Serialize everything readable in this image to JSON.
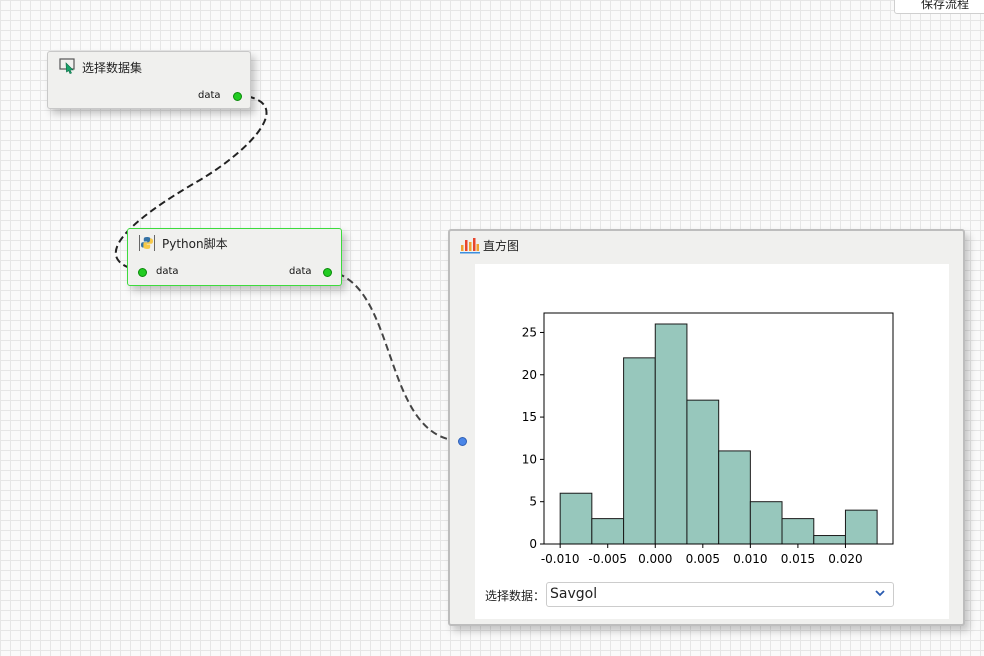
{
  "toolbar": {
    "save_label": "保存流程"
  },
  "nodes": {
    "select_dataset": {
      "title": "选择数据集",
      "out_port": "data"
    },
    "python_script": {
      "title": "Python脚本",
      "in_port": "data",
      "out_port": "data"
    },
    "histogram": {
      "title": "直方图",
      "select_label": "选择数据：",
      "select_value": "Savgol"
    }
  },
  "colors": {
    "bar_fill": "#97c7bc",
    "port_green": "#22cc22",
    "node_border_active": "#3ddb3d",
    "input_port_blue": "#4a86e8"
  },
  "chart_data": {
    "type": "bar",
    "title": "",
    "xlabel": "",
    "ylabel": "",
    "bin_edges": [
      -0.01,
      -0.00667,
      -0.00333,
      0.0,
      0.00333,
      0.00667,
      0.01,
      0.01333,
      0.01667,
      0.02,
      0.02333
    ],
    "values": [
      6,
      3,
      22,
      26,
      17,
      11,
      5,
      3,
      1,
      4
    ],
    "xlim": [
      -0.0117,
      0.025
    ],
    "ylim": [
      0,
      27.3
    ],
    "xticks": [
      -0.01,
      -0.005,
      0.0,
      0.005,
      0.01,
      0.015,
      0.02
    ],
    "xtick_labels": [
      "-0.010",
      "-0.005",
      "0.000",
      "0.005",
      "0.010",
      "0.015",
      "0.020"
    ],
    "yticks": [
      0,
      5,
      10,
      15,
      20,
      25
    ],
    "ytick_labels": [
      "0",
      "5",
      "10",
      "15",
      "20",
      "25"
    ],
    "grid": false
  }
}
